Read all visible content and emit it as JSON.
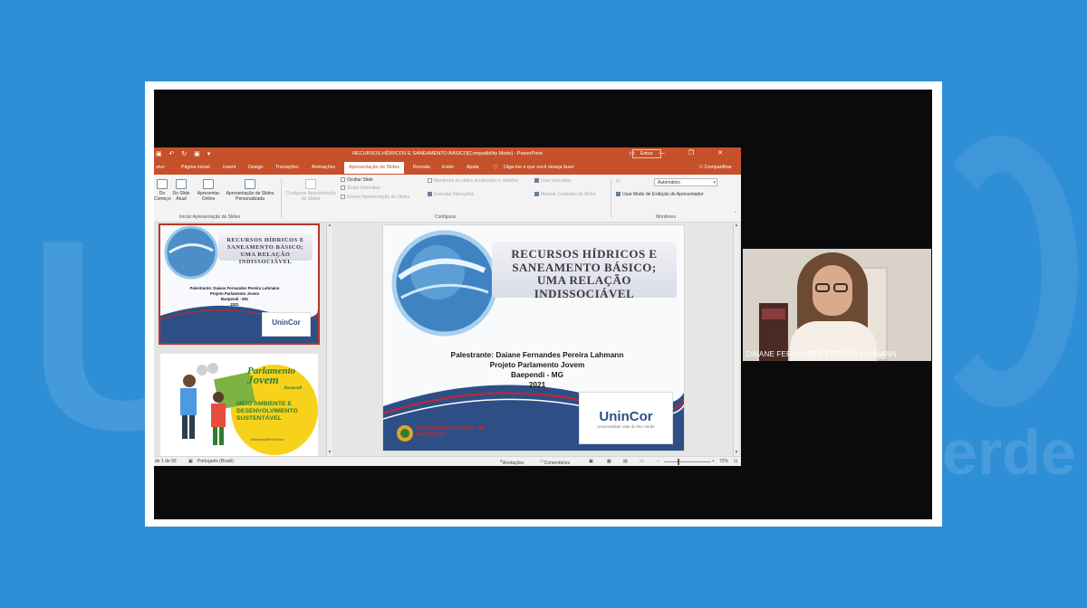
{
  "background": {
    "watermark_left": "Un",
    "watermark_right": "erde"
  },
  "titlebar": {
    "title": "RECURSOS HÍDRICOS E SANEAMENTO BÁSICO[Compatibility Mode] - PowerPoint",
    "signin": "Entrar",
    "window_buttons": "▭ — ❐ ✕"
  },
  "tabs": {
    "items": [
      "uivo",
      "Página Inicial",
      "Inserir",
      "Design",
      "Transições",
      "Animações",
      "Apresentação de Slides",
      "Revisão",
      "Exibir",
      "Ajuda"
    ],
    "tell_me": "Diga-me o que você deseja fazer",
    "share": "Compartilhar",
    "active": "Apresentação de Slides"
  },
  "ribbon": {
    "start_from_beginning": "Do Começo",
    "from_current": "Do Slide Atual",
    "present_online": "Apresentar Online",
    "custom_show": "Apresentação de Slides Personalizada",
    "group_start": "Iniciar Apresentação de Slides",
    "setup_show": "Configurar Apresentação de Slides",
    "hide_slide": "Ocultar Slide",
    "rehearse": "Testar Intervalos",
    "record": "Gravar Apresentação de Slides",
    "keep_updated": "Mantenha os slides atualizados e datados",
    "play_narrations": "Executar Narrações",
    "use_timings": "Usar Intervalos",
    "show_media": "Mostrar Controles de Mídia",
    "group_setup": "Configurar",
    "monitor_select": "Automático",
    "presenter_view": "Usar Modo de Exibição do Apresentador",
    "group_monitors": "Monitores"
  },
  "slide": {
    "title": "RECURSOS HÍDRICOS E SANEAMENTO BÁSICO; UMA RELAÇÃO INDISSOCIÁVEL",
    "speaker": "Palestrante: Daiane Fernandes Pereira Lahmann",
    "project": "Projeto Parlamento Jovem",
    "city": "Baependi - MG",
    "year": "2021",
    "logo": "UninCor",
    "logo_sub": "Universidade Vale do Rio Verde",
    "camara": "CÂMARA MUNICIPAL DE BAEPENDI"
  },
  "thumb2": {
    "line1": "Parlamento",
    "line2": "Jovem",
    "line3": "Baependi",
    "line4": "MEIO AMBIENTE E DESENVOLVIMENTO SUSTENTÁVEL",
    "hashtag": "#BaependiPorTodos"
  },
  "statusbar": {
    "slide_count": "de 1 de 65",
    "language": "Português (Brasil)",
    "notes": "Anotações",
    "comments": "Comentários",
    "zoom": "72%",
    "zoom_minus": "−",
    "zoom_plus": "+"
  },
  "webcam": {
    "name": "DAIANE FERNANDES PEREIRA LAHMANN"
  },
  "colors": {
    "accent": "#c6502a",
    "page_bg": "#2f8fd6",
    "selected_thumb": "#b4372a"
  }
}
